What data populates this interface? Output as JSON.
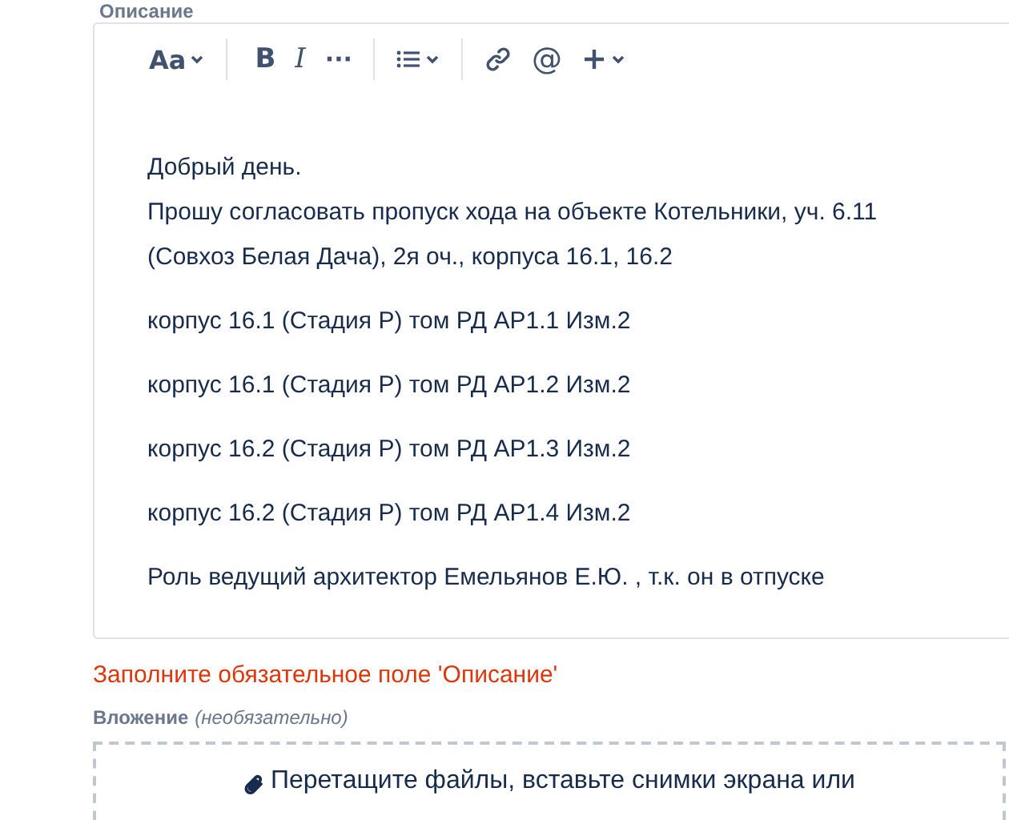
{
  "field_label": "Описание",
  "toolbar": [
    {
      "kind": "text-style",
      "text": "Aa"
    },
    {
      "kind": "separator"
    },
    {
      "kind": "bold",
      "text": "B"
    },
    {
      "kind": "italic",
      "text": "I"
    },
    {
      "kind": "more",
      "text": "···"
    },
    {
      "kind": "separator"
    },
    {
      "kind": "list"
    },
    {
      "kind": "separator"
    },
    {
      "kind": "link"
    },
    {
      "kind": "mention",
      "text": "@"
    },
    {
      "kind": "insert"
    }
  ],
  "paragraphs": [
    [
      "Добрый день.",
      "Прошу согласовать пропуск хода на объекте Котельники, уч. 6.11",
      "(Совхоз Белая Дача), 2я оч., корпуса 16.1, 16.2"
    ],
    [
      "корпус 16.1 (Стадия Р) том РД  АР1.1 Изм.2"
    ],
    [
      "корпус 16.1 (Стадия Р) том РД  АР1.2 Изм.2"
    ],
    [
      "корпус 16.2 (Стадия Р) том РД  АР1.3 Изм.2"
    ],
    [
      "корпус 16.2 (Стадия Р) том РД  АР1.4 Изм.2"
    ],
    [
      "Роль ведущий архитектор Емельянов Е.Ю. , т.к. он в отпуске"
    ]
  ],
  "error": "Заполните обязательное поле 'Описание'",
  "attachment": {
    "label": "Вложение",
    "hint": "(необязательно)",
    "drop_text": "Перетащите файлы, вставьте снимки экрана или"
  }
}
